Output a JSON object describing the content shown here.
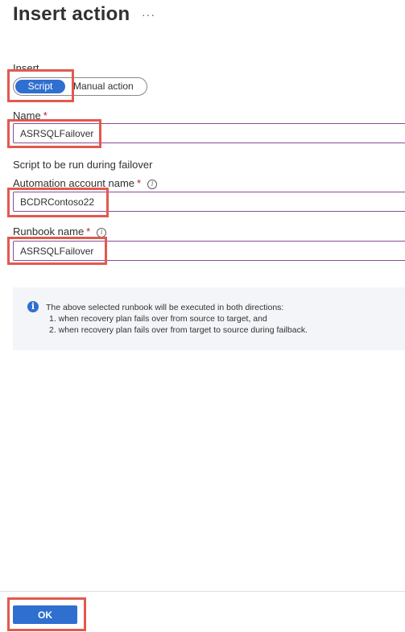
{
  "panel": {
    "title": "Insert action",
    "more_label": "···"
  },
  "insert": {
    "label": "Insert",
    "options": [
      "Script",
      "Manual action"
    ],
    "selected": "Script"
  },
  "name_field": {
    "label": "Name",
    "required_mark": "*",
    "value": "ASRSQLFailover"
  },
  "script_section": {
    "heading": "Script to be run during failover"
  },
  "automation_account": {
    "label": "Automation account name",
    "required_mark": "*",
    "info_icon": "info-icon",
    "value": "BCDRContoso22"
  },
  "runbook": {
    "label": "Runbook name",
    "required_mark": "*",
    "info_icon": "info-icon",
    "value": "ASRSQLFailover"
  },
  "info_message": {
    "icon": "info-icon",
    "line1": "The above selected runbook will be executed in both directions:",
    "line2": "1. when recovery plan fails over from source to target, and",
    "line3": "2. when recovery plan fails over from target to source during failback."
  },
  "footer": {
    "ok_label": "OK"
  },
  "colors": {
    "accent": "#2f6fd0",
    "highlight": "#e05a4e",
    "field_border": "#8a4d97",
    "info_bg": "#f3f5f8"
  }
}
